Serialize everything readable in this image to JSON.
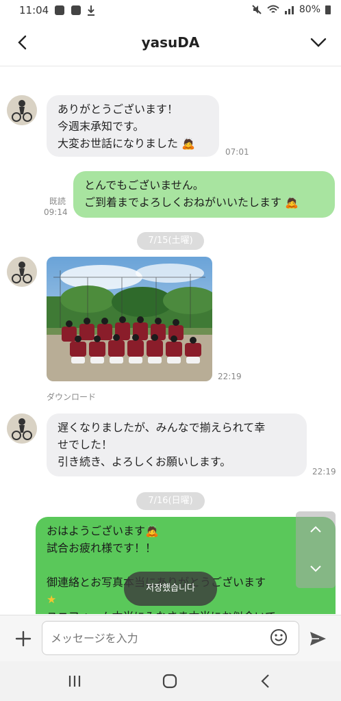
{
  "status_bar": {
    "time": "11:04",
    "battery": "80%"
  },
  "header": {
    "title": "yasuDA"
  },
  "messages": {
    "m1": {
      "lines": [
        "ありがとうございます！",
        "今週末承知です。",
        "大変お世話になりました"
      ],
      "time": "07:01"
    },
    "m2": {
      "lines": [
        "とんでもございません。",
        "ご到着までよろしくおねがいいたします"
      ],
      "read": "既読",
      "time": "09:14"
    },
    "date1": "7/15(土曜)",
    "photo": {
      "time": "22:19",
      "download": "ダウンロード"
    },
    "m3": {
      "lines": [
        "遅くなりましたが、みんなで揃えられて幸",
        "せでした！",
        "引き続き、よろしくお願いします。"
      ],
      "time": "22:19"
    },
    "date2": "7/16(日曜)",
    "m4": {
      "lines": [
        "おはようございます",
        "試合お疲れ様です！！",
        "",
        "御連絡とお写真本当にありがとうございます",
        "",
        "ユニフォーム本当にみなさま本当にお似合いで"
      ]
    }
  },
  "toast": "저장했습니다",
  "input": {
    "placeholder": "メッセージを入力"
  },
  "colors": {
    "out_bubble": "#a8e4a0",
    "green_bubble": "#5ac85a",
    "in_bubble": "#efeff1"
  },
  "icons": [
    "back-icon",
    "chevron-down-icon",
    "plus-icon",
    "emoji-icon",
    "send-icon",
    "recents-icon",
    "home-icon",
    "nav-back-icon"
  ]
}
